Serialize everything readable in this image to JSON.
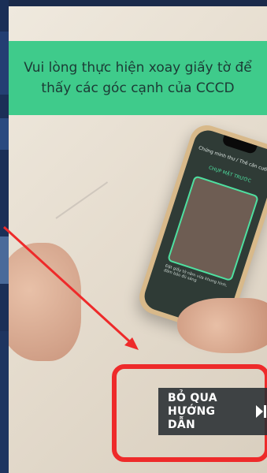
{
  "instruction_banner": {
    "text": "Vui lòng thực hiện xoay giấy tờ để thấy các góc cạnh của CCCD",
    "color": "#3fcb8b"
  },
  "phone_screen": {
    "title": "Chứng minh thư / Thẻ căn cước",
    "tag": "CHỤP MẶT TRƯỚC",
    "hint": "Đặt giấy tờ nằm vừa khung hình, đảm bảo đủ sáng"
  },
  "skip_button": {
    "line1": "BỎ QUA",
    "line2": "HƯỚNG DẪN",
    "icon": "skip-next-icon"
  },
  "annotation": {
    "color": "#ee2a2a"
  }
}
